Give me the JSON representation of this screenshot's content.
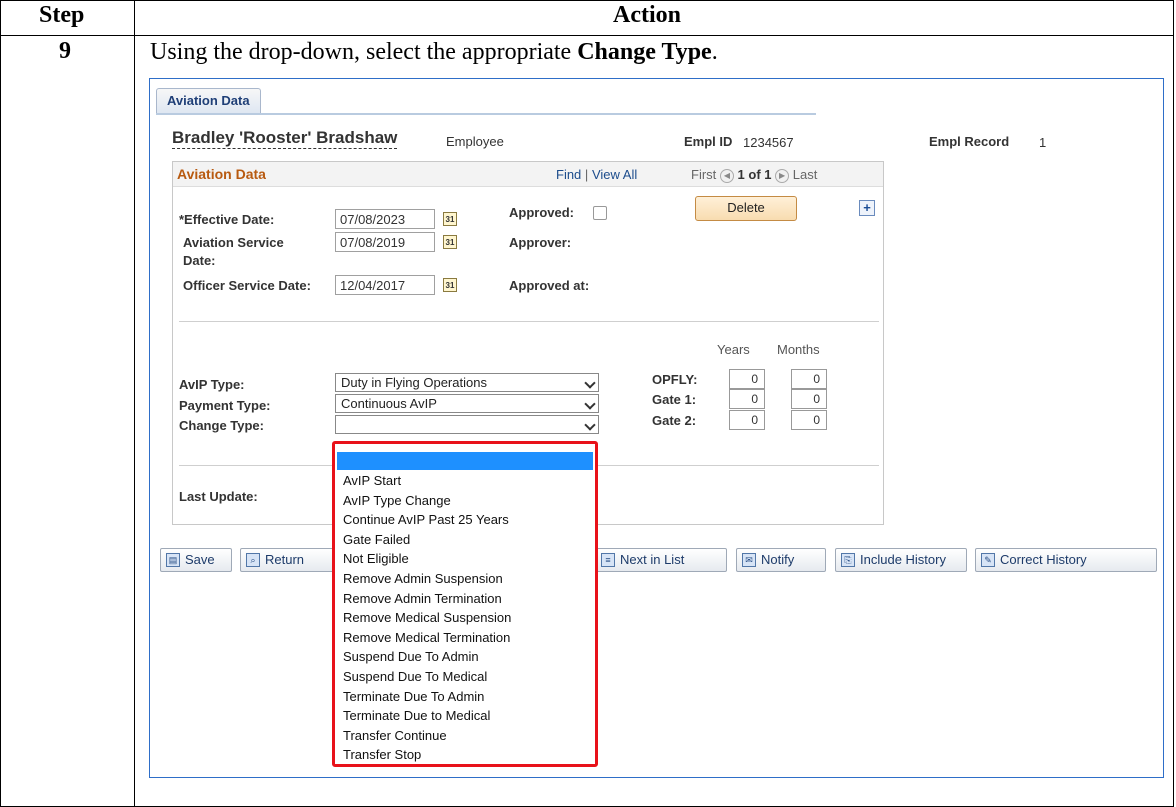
{
  "doc": {
    "header_step": "Step",
    "header_action": "Action",
    "step_number": "9",
    "instruction_prefix": "Using the drop-down, select the appropriate ",
    "instruction_bold": "Change Type",
    "instruction_suffix": "."
  },
  "page": {
    "tab_label": "Aviation Data",
    "person_name": "Bradley 'Rooster' Bradshaw",
    "person_type": "Employee",
    "empl_id_label": "Empl ID",
    "empl_id_value": "1234567",
    "empl_record_label": "Empl Record",
    "empl_record_value": "1"
  },
  "grid": {
    "title": "Aviation Data",
    "find_label": "Find",
    "separator": "|",
    "view_all_label": "View All",
    "first_label": "First",
    "page_counter": "1 of 1",
    "last_label": "Last",
    "delete_label": "Delete",
    "add_icon_glyph": "+"
  },
  "fields": {
    "effective_date_label": "*Effective Date:",
    "effective_date_value": "07/08/2023",
    "aviation_service_label_1": "Aviation Service",
    "aviation_service_label_2": "Date:",
    "aviation_service_value": "07/08/2019",
    "officer_service_label": "Officer Service Date:",
    "officer_service_value": "12/04/2017",
    "approved_label": "Approved:",
    "approver_label": "Approver:",
    "approved_at_label": "Approved at:",
    "calendar_glyph": "31"
  },
  "service": {
    "years_label": "Years",
    "months_label": "Months",
    "avip_type_label": "AvIP Type:",
    "avip_type_value": "Duty in Flying Operations",
    "payment_type_label": "Payment Type:",
    "payment_type_value": "Continuous AvIP",
    "change_type_label": "Change Type:",
    "change_type_value": "",
    "opfly_label": "OPFLY:",
    "opfly_years": "0",
    "opfly_months": "0",
    "gate1_label": "Gate 1:",
    "gate1_years": "0",
    "gate1_months": "0",
    "gate2_label": "Gate 2:",
    "gate2_years": "0",
    "gate2_months": "0",
    "last_update_label": "Last Update:"
  },
  "dropdown_options": [
    "AvIP Start",
    "AvIP Type Change",
    "Continue AvIP Past 25 Years",
    "Gate Failed",
    "Not Eligible",
    "Remove Admin Suspension",
    "Remove Admin Termination",
    "Remove Medical Suspension",
    "Remove Medical Termination",
    "Suspend Due To Admin",
    "Suspend Due To Medical",
    "Terminate Due To Admin",
    "Terminate Due to Medical",
    "Transfer Continue",
    "Transfer Stop"
  ],
  "toolbar": {
    "save_label": "Save",
    "return_label": "Return",
    "next_in_list_label": "Next in List",
    "notify_label": "Notify",
    "include_history_label": "Include History",
    "correct_history_label": "Correct History"
  },
  "colors": {
    "highlight_border": "#e8121a",
    "selection_blue": "#1e90ff",
    "section_title": "#b85a10",
    "frame_border": "#2e6ec8"
  }
}
